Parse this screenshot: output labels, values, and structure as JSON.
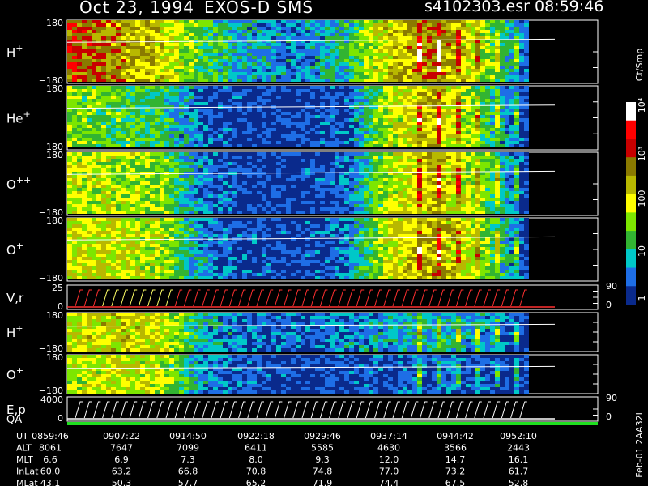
{
  "header": {
    "date": "Oct 23, 1994",
    "instrument": "EXOS-D SMS",
    "file": "s4102303.esr",
    "time": "08:59:46"
  },
  "colors": {
    "background": "#000000",
    "text": "#ffffff",
    "low": "#0a2a8c",
    "high": "#ff0000"
  },
  "chart_data": {
    "type": "heatmap",
    "panels": [
      {
        "id": "hplus-1",
        "label": "H",
        "sup": "+",
        "ymax": "180",
        "ymin": "−180",
        "level": [
          0.75,
          0.65,
          0.55,
          0.3,
          0.2,
          0.15,
          0.25,
          0.55,
          0.7,
          0.45,
          0.1
        ]
      },
      {
        "id": "heplus",
        "label": "He",
        "sup": "+",
        "ymax": "180",
        "ymin": "−180",
        "level": [
          0.4,
          0.35,
          0.3,
          0.1,
          0.05,
          0.05,
          0.08,
          0.45,
          0.6,
          0.35,
          0.05
        ]
      },
      {
        "id": "oplusplus",
        "label": "O",
        "sup": "++",
        "ymax": "180",
        "ymin": "−180",
        "level": [
          0.45,
          0.45,
          0.4,
          0.12,
          0.05,
          0.05,
          0.1,
          0.45,
          0.6,
          0.4,
          0.05
        ]
      },
      {
        "id": "oplus-1",
        "label": "O",
        "sup": "+",
        "ymax": "180",
        "ymin": "−180",
        "level": [
          0.5,
          0.5,
          0.45,
          0.15,
          0.08,
          0.05,
          0.12,
          0.5,
          0.62,
          0.45,
          0.05
        ]
      },
      {
        "id": "vr",
        "label": "V,r",
        "sup": "",
        "ymax": "25",
        "ymin": "0",
        "yright_top": "90",
        "yright_bottom": "0"
      },
      {
        "id": "hplus-2",
        "label": "H",
        "sup": "+",
        "ymax": "180",
        "ymin": "−180",
        "level": [
          0.5,
          0.55,
          0.5,
          0.2,
          0.1,
          0.1,
          0.15,
          0.2,
          0.25,
          0.2,
          0.05
        ]
      },
      {
        "id": "oplus-2",
        "label": "O",
        "sup": "+",
        "ymax": "180",
        "ymin": "−180",
        "level": [
          0.45,
          0.5,
          0.45,
          0.15,
          0.08,
          0.05,
          0.08,
          0.08,
          0.1,
          0.08,
          0.05
        ]
      },
      {
        "id": "ep",
        "label": "E,p",
        "sup": "",
        "ymax": "4000",
        "ymin": "0",
        "yright_top": "90",
        "yright_bottom": "0"
      }
    ],
    "qa_label": "QA",
    "colorbar": {
      "unit": "Ct/Smp",
      "ticks": [
        "10⁴",
        "10³",
        "100",
        "10",
        "1"
      ],
      "levels": [
        10000,
        1000,
        100,
        10,
        1
      ],
      "colors": [
        "#ffffff",
        "#ff0000",
        "#c80000",
        "#8a7a00",
        "#b8b800",
        "#ffff00",
        "#7de600",
        "#32b432",
        "#00c8c8",
        "#1e6ee6",
        "#0a2a8c"
      ]
    },
    "table": {
      "rows": [
        {
          "name": "UT",
          "values": [
            "0859:46",
            "0907:22",
            "0914:50",
            "0922:18",
            "0929:46",
            "0937:14",
            "0944:42",
            "0952:10"
          ]
        },
        {
          "name": "ALT",
          "values": [
            "8061",
            "7647",
            "7099",
            "6411",
            "5585",
            "4630",
            "3566",
            "2443"
          ]
        },
        {
          "name": "MLT",
          "values": [
            "6.6",
            "6.9",
            "7.3",
            "8.0",
            "9.3",
            "12.0",
            "14.7",
            "16.1"
          ]
        },
        {
          "name": "InLat",
          "values": [
            "60.0",
            "63.2",
            "66.8",
            "70.8",
            "74.8",
            "77.0",
            "73.2",
            "61.7"
          ]
        },
        {
          "name": "MLat",
          "values": [
            "43.1",
            "50.3",
            "57.7",
            "65.2",
            "71.9",
            "74.4",
            "67.5",
            "52.8"
          ]
        }
      ]
    },
    "footer_tag": "Feb-01 2AA32L"
  }
}
